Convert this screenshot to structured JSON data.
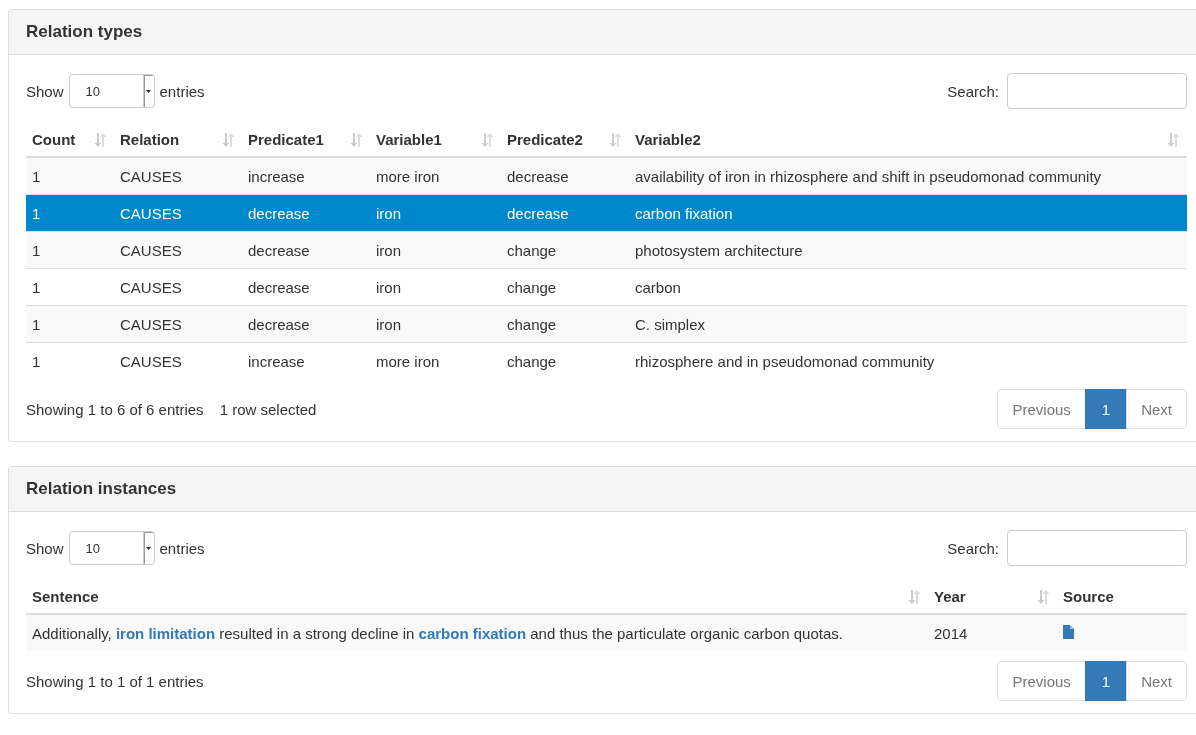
{
  "panels": [
    {
      "title": "Relation types",
      "length_label_before": "Show",
      "length_value": "10",
      "length_label_after": "entries",
      "search_label": "Search:",
      "columns": [
        {
          "label": "Count"
        },
        {
          "label": "Relation"
        },
        {
          "label": "Predicate1"
        },
        {
          "label": "Variable1"
        },
        {
          "label": "Predicate2"
        },
        {
          "label": "Variable2"
        }
      ],
      "rows": [
        {
          "selected": false,
          "cells": [
            "1",
            "CAUSES",
            "increase",
            "more iron",
            "decrease",
            "availability of iron in rhizosphere and shift in pseudomonad community"
          ]
        },
        {
          "selected": true,
          "cells": [
            "1",
            "CAUSES",
            "decrease",
            "iron",
            "decrease",
            "carbon fixation"
          ]
        },
        {
          "selected": false,
          "cells": [
            "1",
            "CAUSES",
            "decrease",
            "iron",
            "change",
            "photosystem architecture"
          ]
        },
        {
          "selected": false,
          "cells": [
            "1",
            "CAUSES",
            "decrease",
            "iron",
            "change",
            "carbon"
          ]
        },
        {
          "selected": false,
          "cells": [
            "1",
            "CAUSES",
            "decrease",
            "iron",
            "change",
            "C. simplex"
          ]
        },
        {
          "selected": false,
          "cells": [
            "1",
            "CAUSES",
            "increase",
            "more iron",
            "change",
            "rhizosphere and in pseudomonad community"
          ]
        }
      ],
      "info": "Showing 1 to 6 of 6 entries",
      "select_info": "1 row selected",
      "pages": [
        {
          "label": "Previous",
          "selected": false
        },
        {
          "label": "1",
          "selected": true
        },
        {
          "label": "Next",
          "selected": false
        }
      ]
    },
    {
      "title": "Relation instances",
      "length_label_before": "Show",
      "length_value": "10",
      "length_label_after": "entries",
      "search_label": "Search:",
      "columns": [
        {
          "label": "Sentence"
        },
        {
          "label": "Year"
        },
        {
          "label": "Source"
        }
      ],
      "rows": [
        {
          "selected": false,
          "cells": [
            "Additionally, **iron limitation** resulted in a strong decline in **carbon fixation** and thus the particulate organic carbon quotas.",
            "2014",
            {
              "kind": "document"
            }
          ]
        }
      ],
      "info": "Showing 1 to 1 of 1 entries",
      "pages": [
        {
          "label": "Previous",
          "selected": false
        },
        {
          "label": "1",
          "selected": true
        },
        {
          "label": "Next",
          "selected": false
        }
      ]
    }
  ]
}
